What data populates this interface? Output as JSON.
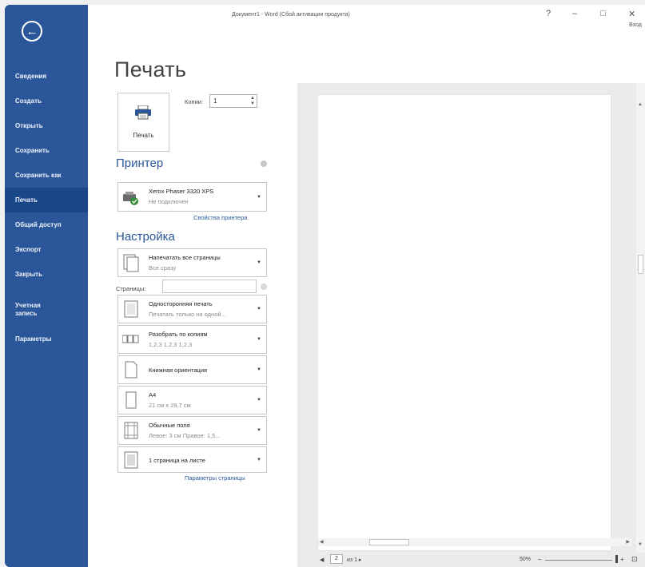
{
  "window": {
    "title": "Документ1 - Word (Сбой активации продукта)",
    "help": "?",
    "minimize": "–",
    "restore": "□",
    "close": "✕",
    "signin": "Вход"
  },
  "sidebar": {
    "back_icon": "back-arrow-icon",
    "items": [
      {
        "label": "Сведения",
        "active": false
      },
      {
        "label": "Создать",
        "active": false
      },
      {
        "label": "Открыть",
        "active": false
      },
      {
        "label": "Сохранить",
        "active": false
      },
      {
        "label": "Сохранить как",
        "active": false
      },
      {
        "label": "Печать",
        "active": true
      },
      {
        "label": "Общий доступ",
        "active": false
      },
      {
        "label": "Экспорт",
        "active": false
      },
      {
        "label": "Закрыть",
        "active": false
      }
    ],
    "account_line1": "Учетная",
    "account_line2": "запись",
    "options": "Параметры"
  },
  "print": {
    "heading": "Печать",
    "button_label": "Печать",
    "copies_label": "Копии:",
    "copies_value": "1"
  },
  "printer": {
    "section_title": "Принтер",
    "name": "Xerox Phaser 3320 XPS",
    "status": "Не подключен",
    "properties_link": "Свойства принтера"
  },
  "settings": {
    "section_title": "Настройка",
    "what": {
      "main": "Напечатать все страницы",
      "sub": "Все сразу"
    },
    "pages_label": "Страницы:",
    "pages_value": "",
    "sides": {
      "main": "Односторонняя печать",
      "sub": "Печатать только на одной..."
    },
    "collate": {
      "main": "Разобрать по копиям",
      "sub": "1,2,3   1,2,3   1,2,3"
    },
    "orientation": {
      "main": "Книжная ориентация"
    },
    "paper": {
      "main": "A4",
      "sub": "21 см x 29,7 см"
    },
    "margins": {
      "main": "Обычные поля",
      "sub": "Левое: 3 см   Правое: 1,5..."
    },
    "per_sheet": {
      "main": "1 страница на листе"
    },
    "page_setup_link": "Параметры страницы"
  },
  "preview": {
    "current_page": "2",
    "of_pages": "из 1 ▸",
    "zoom": "50%",
    "zoom_level_fraction": 0.5
  }
}
